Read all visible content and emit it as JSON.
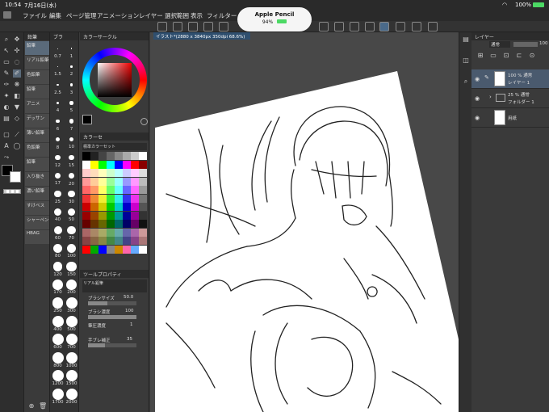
{
  "status": {
    "time": "10:54",
    "date": "7月16日(水)",
    "battery": "100%"
  },
  "menu": [
    "ファイル",
    "編集",
    "ページ管理",
    "アニメーション",
    "レイヤー",
    "選択範囲",
    "表示",
    "フィルター"
  ],
  "pencil": {
    "title": "Apple Pencil",
    "level": "94%"
  },
  "document": {
    "tab_label": "イラスト*(2880 x 3840px 350dpi 68.6%)"
  },
  "subtool": {
    "header": "鉛筆",
    "items": [
      "鉛筆",
      "リアル鉛筆",
      "色鉛筆",
      "鉛筆",
      "アニメ",
      "デッサン",
      "薄い鉛筆",
      "色鉛筆",
      "鉛筆",
      "入り抜き",
      "濃い鉛筆",
      "すけベス",
      "シャーペン",
      "HBAG"
    ]
  },
  "brush_sizes": {
    "header": "ブラ",
    "values": [
      "0.7",
      "1",
      "1.5",
      "2",
      "2.5",
      "3",
      "4",
      "5",
      "6",
      "7",
      "8",
      "10",
      "12",
      "15",
      "17",
      "20",
      "25",
      "30",
      "40",
      "50",
      "60",
      "70",
      "80",
      "100",
      "120",
      "150",
      "170",
      "200",
      "250",
      "300",
      "400",
      "500",
      "600",
      "700",
      "800",
      "1000",
      "1200",
      "1500",
      "1700",
      "2000"
    ]
  },
  "color_circle": {
    "header": "カラーサークル"
  },
  "color_set": {
    "header": "カラーセ",
    "name": "標準カラーセット"
  },
  "tool_property": {
    "header": "ツールプロパティ",
    "tool_name": "リアル鉛筆",
    "brush_size_label": "ブラシサイズ",
    "brush_size_value": "50.0",
    "brush_density_label": "ブラシ濃度",
    "brush_density_value": "100",
    "correction_label": "筆圧濃度",
    "correction_value": "1",
    "stabilization_label": "手ブレ補正",
    "stabilization_value": "35"
  },
  "layer_panel": {
    "header": "レイヤー",
    "blend_mode": "通常",
    "opacity": "100",
    "layers": [
      {
        "info": "100 % 通常",
        "name": "レイヤー 1"
      },
      {
        "info": "25 % 通常",
        "name": "フォルダー 1"
      },
      {
        "info": "",
        "name": "用紙"
      }
    ]
  },
  "colors": {
    "accent": "#2f4f6f",
    "panel": "#3a3a3a",
    "dark": "#2a2a2a"
  }
}
